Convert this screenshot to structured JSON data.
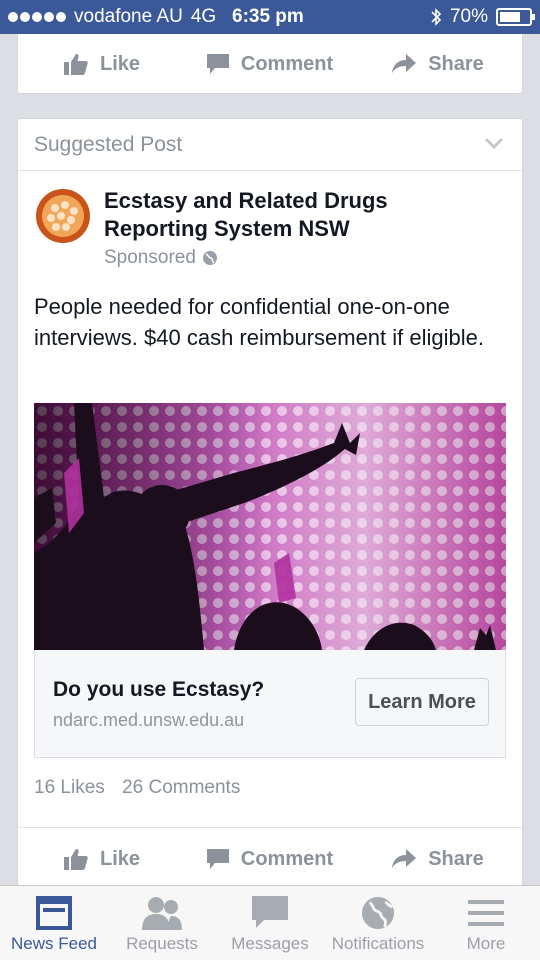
{
  "status_bar": {
    "carrier": "vodafone AU",
    "network": "4G",
    "time": "6:35 pm",
    "battery": "70%",
    "battery_level": 0.7
  },
  "top_actions": {
    "like": "Like",
    "comment": "Comment",
    "share": "Share"
  },
  "post": {
    "header": "Suggested Post",
    "page_name": "Ecstasy and Related Drugs Reporting System NSW",
    "sponsored": "Sponsored",
    "text": "People needed for confidential one-on-one interviews. $40 cash reimbursement if eligible.",
    "link": {
      "title": "Do you use Ecstasy?",
      "url": "ndarc.med.unsw.edu.au",
      "cta": "Learn More"
    },
    "likes": "16 Likes",
    "comments": "26 Comments",
    "actions": {
      "like": "Like",
      "comment": "Comment",
      "share": "Share"
    }
  },
  "tabbar": {
    "items": [
      {
        "label": "News Feed",
        "icon": "news-feed-icon",
        "active": true
      },
      {
        "label": "Requests",
        "icon": "friend-requests-icon",
        "active": false
      },
      {
        "label": "Messages",
        "icon": "messages-icon",
        "active": false
      },
      {
        "label": "Notifications",
        "icon": "globe-icon",
        "active": false
      },
      {
        "label": "More",
        "icon": "menu-icon",
        "active": false
      }
    ]
  },
  "colors": {
    "brand": "#3b5998",
    "muted": "#8c929c"
  }
}
